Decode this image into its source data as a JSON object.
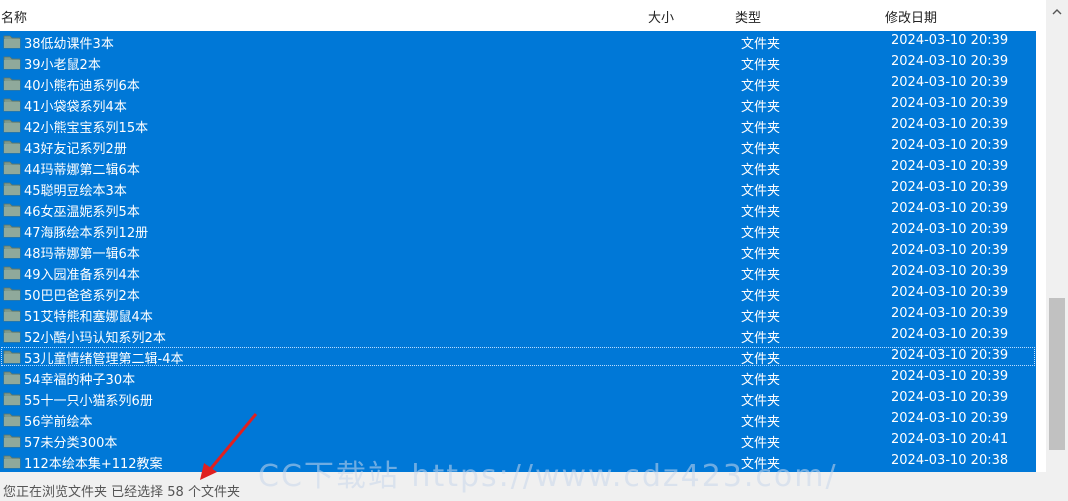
{
  "header": {
    "col_name": "名称",
    "col_size": "大小",
    "col_type": "类型",
    "col_date": "修改日期"
  },
  "rows": [
    {
      "name": "38低幼课件3本",
      "type": "文件夹",
      "date": "2024-03-10 20:39"
    },
    {
      "name": "39小老鼠2本",
      "type": "文件夹",
      "date": "2024-03-10 20:39"
    },
    {
      "name": "40小熊布迪系列6本",
      "type": "文件夹",
      "date": "2024-03-10 20:39"
    },
    {
      "name": "41小袋袋系列4本",
      "type": "文件夹",
      "date": "2024-03-10 20:39"
    },
    {
      "name": "42小熊宝宝系列15本",
      "type": "文件夹",
      "date": "2024-03-10 20:39"
    },
    {
      "name": "43好友记系列2册",
      "type": "文件夹",
      "date": "2024-03-10 20:39"
    },
    {
      "name": "44玛蒂娜第二辑6本",
      "type": "文件夹",
      "date": "2024-03-10 20:39"
    },
    {
      "name": "45聪明豆绘本3本",
      "type": "文件夹",
      "date": "2024-03-10 20:39"
    },
    {
      "name": "46女巫温妮系列5本",
      "type": "文件夹",
      "date": "2024-03-10 20:39"
    },
    {
      "name": "47海豚绘本系列12册",
      "type": "文件夹",
      "date": "2024-03-10 20:39"
    },
    {
      "name": "48玛蒂娜第一辑6本",
      "type": "文件夹",
      "date": "2024-03-10 20:39"
    },
    {
      "name": "49入园准备系列4本",
      "type": "文件夹",
      "date": "2024-03-10 20:39"
    },
    {
      "name": "50巴巴爸爸系列2本",
      "type": "文件夹",
      "date": "2024-03-10 20:39"
    },
    {
      "name": "51艾特熊和塞娜鼠4本",
      "type": "文件夹",
      "date": "2024-03-10 20:39"
    },
    {
      "name": "52小酷小玛认知系列2本",
      "type": "文件夹",
      "date": "2024-03-10 20:39"
    },
    {
      "name": "53儿童情绪管理第二辑-4本",
      "type": "文件夹",
      "date": "2024-03-10 20:39"
    },
    {
      "name": "54幸福的种子30本",
      "type": "文件夹",
      "date": "2024-03-10 20:39"
    },
    {
      "name": "55十一只小猫系列6册",
      "type": "文件夹",
      "date": "2024-03-10 20:39"
    },
    {
      "name": "56学前绘本",
      "type": "文件夹",
      "date": "2024-03-10 20:39"
    },
    {
      "name": "57未分类300本",
      "type": "文件夹",
      "date": "2024-03-10 20:41"
    },
    {
      "name": "112本绘本集+112教案",
      "type": "文件夹",
      "date": "2024-03-10 20:38"
    }
  ],
  "status": {
    "text": "您正在浏览文件夹 已经选择 58 个文件夹"
  },
  "watermark": {
    "text": "CC下载站 https://www.cdz423.com/"
  },
  "colors": {
    "selection": "#0078d7",
    "folder": "#7f9a8c",
    "arrow": "#e02020"
  },
  "icons": {
    "folder": "folder-icon",
    "scroll_up": "chevron-up-icon",
    "annotation": "red-arrow-icon"
  }
}
